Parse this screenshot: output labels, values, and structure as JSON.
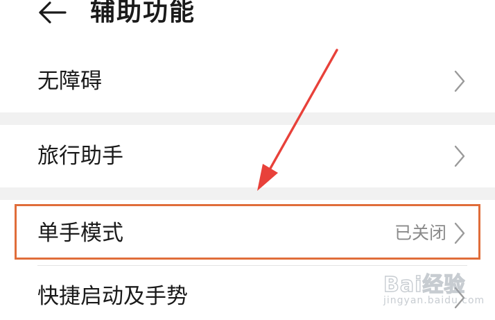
{
  "header": {
    "back_icon": "back-arrow-icon",
    "title": "辅助功能"
  },
  "rows": [
    {
      "label": "无障碍",
      "status": "",
      "icon": "chevron-right-icon"
    },
    {
      "label": "旅行助手",
      "status": "",
      "icon": "chevron-right-icon"
    },
    {
      "label": "单手模式",
      "status": "已关闭",
      "icon": "chevron-right-icon"
    },
    {
      "label": "快捷启动及手势",
      "status": "",
      "icon": "chevron-right-icon"
    }
  ],
  "annotation": {
    "highlight_color": "#e06d3a",
    "arrow_color": "#e8413a",
    "highlighted_row": "单手模式"
  },
  "watermark": {
    "brand": "Bai经验",
    "url": "jingyan.baidu.com"
  }
}
